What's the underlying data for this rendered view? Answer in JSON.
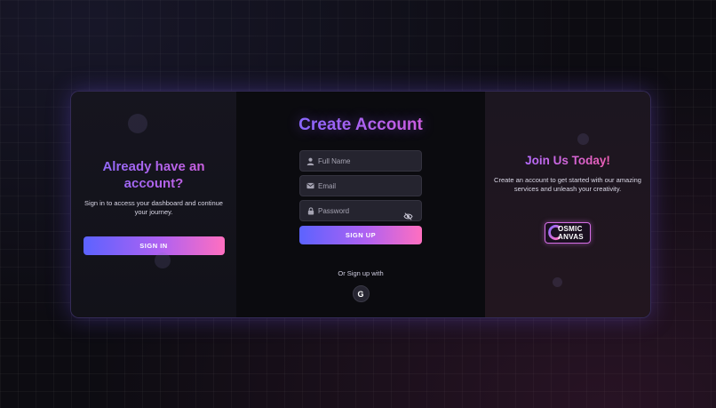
{
  "left_panel": {
    "title": "Already have an account?",
    "description": "Sign in to access your dashboard and continue your journey.",
    "signin_label": "SIGN IN"
  },
  "form": {
    "title": "Create Account",
    "full_name_placeholder": "Full Name",
    "email_placeholder": "Email",
    "password_placeholder": "Password",
    "signup_label": "SIGN UP",
    "social_prompt": "Or Sign up with",
    "google_label": "G"
  },
  "right_panel": {
    "title": "Join Us Today!",
    "description": "Create an account to get started with our amazing services and unleash your creativity.",
    "logo_line1": "OSMIC",
    "logo_line2": "ANVAS"
  },
  "icons": {
    "name_field": "user-icon",
    "email_field": "envelope-icon",
    "password_field": "lock-icon",
    "password_toggle": "eye-slash-icon",
    "social": "google-icon"
  },
  "colors": {
    "accent_start": "#5c63ff",
    "accent_mid": "#b061f1",
    "accent_end": "#ff6fc0",
    "title_purple": "#8a6bff",
    "title_pink": "#ef5fb4",
    "background": "#0d0c12"
  }
}
